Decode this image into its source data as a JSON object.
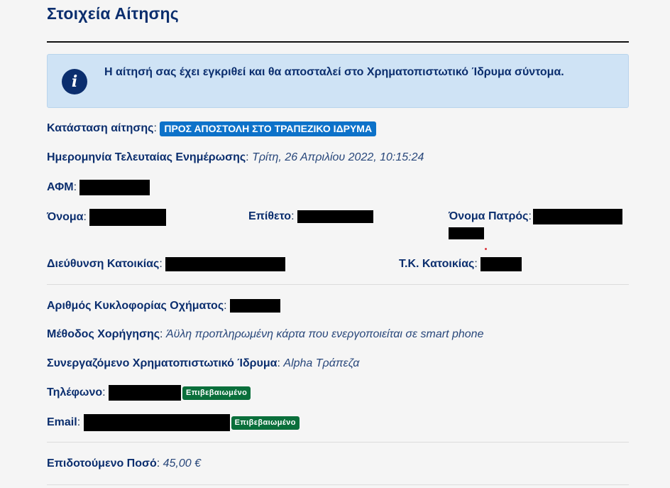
{
  "page": {
    "title": "Στοιχεία Αίτησης"
  },
  "alert": {
    "icon": "info-icon",
    "glyph": "i",
    "message": "Η αίτησή σας έχει εγκριθεί και θα αποσταλεί στο Χρηματοπιστωτικό Ίδρυμα σύντομα."
  },
  "fields": {
    "status": {
      "label": "Κατάσταση αίτησης",
      "value": "ΠΡΟΣ ΑΠΟΣΤΟΛΗ ΣΤΟ ΤΡΑΠΕΖΙΚΟ ΙΔΡΥΜΑ"
    },
    "last_update": {
      "label": "Ημερομηνία Τελευταίας Ενημέρωσης",
      "value": "Τρίτη, 26 Απριλίου 2022, 10:15:24"
    },
    "afm": {
      "label": "ΑΦΜ"
    },
    "first_name": {
      "label": "Όνομα"
    },
    "last_name": {
      "label": "Επίθετο"
    },
    "father_name": {
      "label": "Όνομα Πατρός"
    },
    "address": {
      "label": "Διεύθυνση Κατοικίας"
    },
    "postal_code": {
      "label": "Τ.Κ. Κατοικίας"
    },
    "vehicle_plate": {
      "label": "Αριθμός Κυκλοφορίας Οχήματος"
    },
    "grant_method": {
      "label": "Μέθοδος Χορήγησης",
      "value": "Άϋλη προπληρωμένη κάρτα που ενεργοποιείται σε smart phone"
    },
    "bank": {
      "label": "Συνεργαζόμενο Χρηματοπιστωτικό Ίδρυμα",
      "value": "Alpha Τράπεζα"
    },
    "phone": {
      "label": "Τηλέφωνο",
      "badge": "Επιβεβαιωμένο"
    },
    "email": {
      "label": "Email",
      "badge": "Επιβεβαιωμένο"
    },
    "amount": {
      "label": "Επιδοτούμενο Ποσό",
      "value": "45,00 €"
    }
  },
  "colors": {
    "heading": "#0b2e6e",
    "status_badge": "#0d72c9",
    "verified_badge": "#0a6f3b",
    "alert_bg": "#cfe3f5",
    "redaction": "#000000"
  }
}
